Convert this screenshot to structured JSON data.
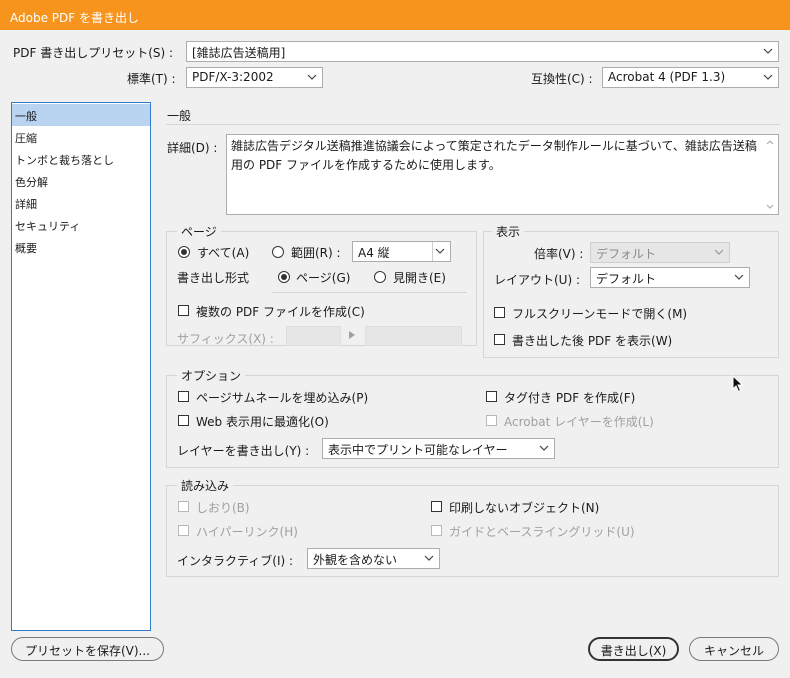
{
  "window": {
    "title": "Adobe PDF を書き出し"
  },
  "header": {
    "preset_label": "PDF 書き出しプリセット(S) :",
    "preset_value": "[雑誌広告送稿用]",
    "standard_label": "標準(T) :",
    "standard_value": "PDF/X-3:2002",
    "compat_label": "互換性(C) :",
    "compat_value": "Acrobat 4 (PDF 1.3)"
  },
  "sidebar": {
    "items": [
      {
        "label": "一般"
      },
      {
        "label": "圧縮"
      },
      {
        "label": "トンボと裁ち落とし"
      },
      {
        "label": "色分解"
      },
      {
        "label": "詳細"
      },
      {
        "label": "セキュリティ"
      },
      {
        "label": "概要"
      }
    ],
    "selected_index": 0
  },
  "panel": {
    "title": "一般",
    "description_label": "詳細(D) :",
    "description_text": "雑誌広告デジタル送稿推進協議会によって策定されたデータ制作ルールに基づいて、雑誌広告送稿用の PDF ファイルを作成するために使用します。"
  },
  "pages": {
    "title": "ページ",
    "all_label": "すべて(A)",
    "range_label": "範囲(R) :",
    "range_value": "A4 縦",
    "export_as_label": "書き出し形式",
    "pages_label": "ページ(G)",
    "spreads_label": "見開き(E)",
    "multi_pdf_label": "複数の PDF ファイルを作成(C)",
    "suffix_label": "サフィックス(X) :"
  },
  "view": {
    "title": "表示",
    "zoom_label": "倍率(V) :",
    "zoom_value": "デフォルト",
    "layout_label": "レイアウト(U) :",
    "layout_value": "デフォルト",
    "fullscreen_label": "フルスクリーンモードで開く(M)",
    "view_after_label": "書き出した後 PDF を表示(W)"
  },
  "options": {
    "title": "オプション",
    "thumbnails_label": "ページサムネールを埋め込み(P)",
    "web_label": "Web 表示用に最適化(O)",
    "tagged_label": "タグ付き PDF を作成(F)",
    "acrobat_layers_label": "Acrobat レイヤーを作成(L)",
    "export_layers_label": "レイヤーを書き出し(Y) :",
    "export_layers_value": "表示中でプリント可能なレイヤー"
  },
  "include": {
    "title": "読み込み",
    "bookmarks_label": "しおり(B)",
    "hyperlinks_label": "ハイパーリンク(H)",
    "nonprinting_label": "印刷しないオブジェクト(N)",
    "guides_label": "ガイドとベースライングリッド(U)",
    "interactive_label": "インタラクティブ(I) :",
    "interactive_value": "外観を含めない"
  },
  "footer": {
    "save_preset_label": "プリセットを保存(V)...",
    "export_label": "書き出し(X)",
    "cancel_label": "キャンセル"
  }
}
